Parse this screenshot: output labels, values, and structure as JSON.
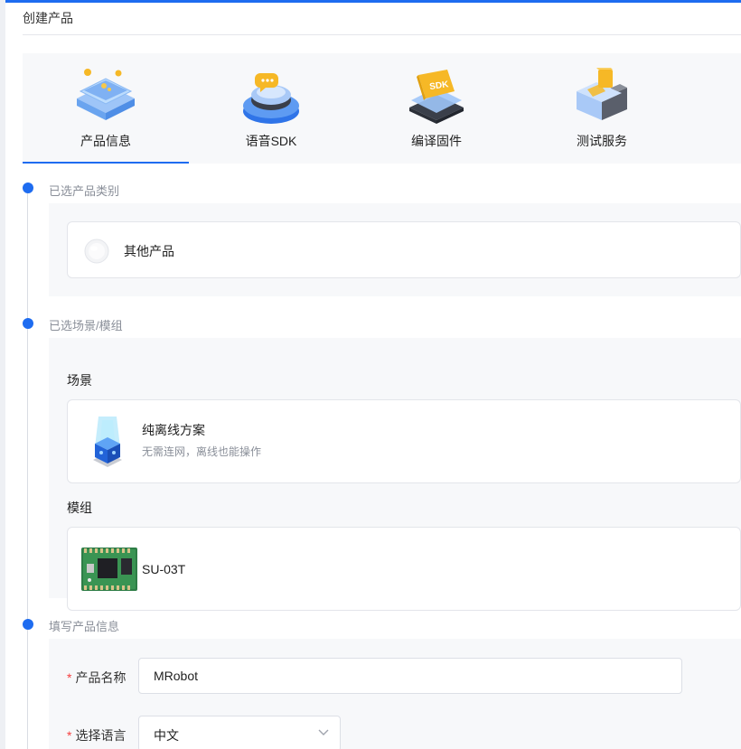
{
  "page": {
    "title": "创建产品"
  },
  "steps": [
    {
      "label": "产品信息",
      "icon": "product-info-icon",
      "active": true
    },
    {
      "label": "语音SDK",
      "icon": "voice-sdk-icon",
      "active": false
    },
    {
      "label": "编译固件",
      "icon": "compile-firmware-icon",
      "active": false
    },
    {
      "label": "测试服务",
      "icon": "test-service-icon",
      "active": false
    }
  ],
  "sections": {
    "category": {
      "label": "已选产品类别",
      "selected": {
        "name": "其他产品",
        "icon": "other-product-icon"
      }
    },
    "scene_module": {
      "label": "已选场景/模组",
      "scene_title": "场景",
      "scene": {
        "name": "纯离线方案",
        "desc": "无需连网，离线也能操作",
        "icon": "offline-cube-icon"
      },
      "module_title": "模组",
      "module": {
        "name": "SU-03T",
        "icon": "module-board-icon"
      }
    },
    "product_info": {
      "label": "填写产品信息",
      "fields": {
        "name": {
          "label": "产品名称",
          "required": true,
          "value": "MRobot"
        },
        "language": {
          "label": "选择语言",
          "required": true,
          "value": "中文"
        }
      }
    }
  },
  "colors": {
    "accent": "#1e6cf0",
    "required": "#f53f3f",
    "panel": "#f7f8fa"
  }
}
